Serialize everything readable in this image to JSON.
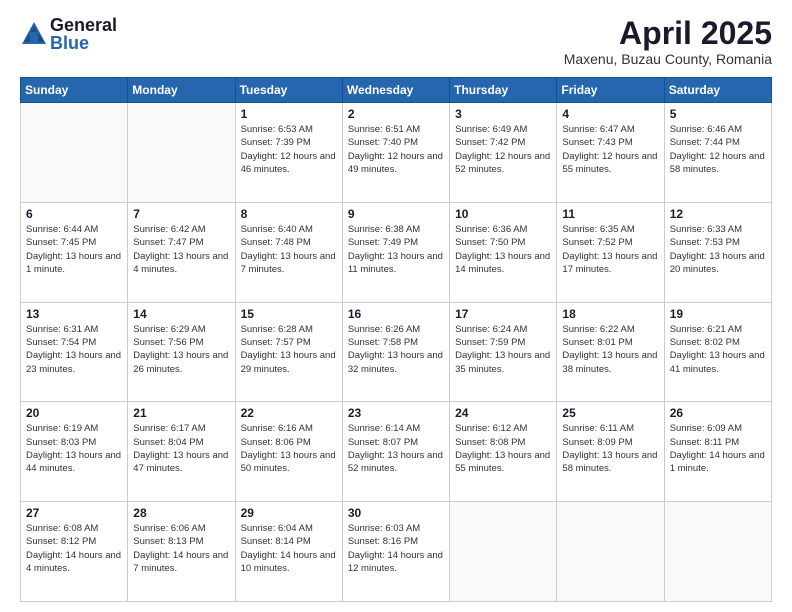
{
  "logo": {
    "general": "General",
    "blue": "Blue"
  },
  "title": {
    "month": "April 2025",
    "location": "Maxenu, Buzau County, Romania"
  },
  "days_header": [
    "Sunday",
    "Monday",
    "Tuesday",
    "Wednesday",
    "Thursday",
    "Friday",
    "Saturday"
  ],
  "weeks": [
    [
      {
        "day": "",
        "text": ""
      },
      {
        "day": "",
        "text": ""
      },
      {
        "day": "1",
        "text": "Sunrise: 6:53 AM\nSunset: 7:39 PM\nDaylight: 12 hours and 46 minutes."
      },
      {
        "day": "2",
        "text": "Sunrise: 6:51 AM\nSunset: 7:40 PM\nDaylight: 12 hours and 49 minutes."
      },
      {
        "day": "3",
        "text": "Sunrise: 6:49 AM\nSunset: 7:42 PM\nDaylight: 12 hours and 52 minutes."
      },
      {
        "day": "4",
        "text": "Sunrise: 6:47 AM\nSunset: 7:43 PM\nDaylight: 12 hours and 55 minutes."
      },
      {
        "day": "5",
        "text": "Sunrise: 6:46 AM\nSunset: 7:44 PM\nDaylight: 12 hours and 58 minutes."
      }
    ],
    [
      {
        "day": "6",
        "text": "Sunrise: 6:44 AM\nSunset: 7:45 PM\nDaylight: 13 hours and 1 minute."
      },
      {
        "day": "7",
        "text": "Sunrise: 6:42 AM\nSunset: 7:47 PM\nDaylight: 13 hours and 4 minutes."
      },
      {
        "day": "8",
        "text": "Sunrise: 6:40 AM\nSunset: 7:48 PM\nDaylight: 13 hours and 7 minutes."
      },
      {
        "day": "9",
        "text": "Sunrise: 6:38 AM\nSunset: 7:49 PM\nDaylight: 13 hours and 11 minutes."
      },
      {
        "day": "10",
        "text": "Sunrise: 6:36 AM\nSunset: 7:50 PM\nDaylight: 13 hours and 14 minutes."
      },
      {
        "day": "11",
        "text": "Sunrise: 6:35 AM\nSunset: 7:52 PM\nDaylight: 13 hours and 17 minutes."
      },
      {
        "day": "12",
        "text": "Sunrise: 6:33 AM\nSunset: 7:53 PM\nDaylight: 13 hours and 20 minutes."
      }
    ],
    [
      {
        "day": "13",
        "text": "Sunrise: 6:31 AM\nSunset: 7:54 PM\nDaylight: 13 hours and 23 minutes."
      },
      {
        "day": "14",
        "text": "Sunrise: 6:29 AM\nSunset: 7:56 PM\nDaylight: 13 hours and 26 minutes."
      },
      {
        "day": "15",
        "text": "Sunrise: 6:28 AM\nSunset: 7:57 PM\nDaylight: 13 hours and 29 minutes."
      },
      {
        "day": "16",
        "text": "Sunrise: 6:26 AM\nSunset: 7:58 PM\nDaylight: 13 hours and 32 minutes."
      },
      {
        "day": "17",
        "text": "Sunrise: 6:24 AM\nSunset: 7:59 PM\nDaylight: 13 hours and 35 minutes."
      },
      {
        "day": "18",
        "text": "Sunrise: 6:22 AM\nSunset: 8:01 PM\nDaylight: 13 hours and 38 minutes."
      },
      {
        "day": "19",
        "text": "Sunrise: 6:21 AM\nSunset: 8:02 PM\nDaylight: 13 hours and 41 minutes."
      }
    ],
    [
      {
        "day": "20",
        "text": "Sunrise: 6:19 AM\nSunset: 8:03 PM\nDaylight: 13 hours and 44 minutes."
      },
      {
        "day": "21",
        "text": "Sunrise: 6:17 AM\nSunset: 8:04 PM\nDaylight: 13 hours and 47 minutes."
      },
      {
        "day": "22",
        "text": "Sunrise: 6:16 AM\nSunset: 8:06 PM\nDaylight: 13 hours and 50 minutes."
      },
      {
        "day": "23",
        "text": "Sunrise: 6:14 AM\nSunset: 8:07 PM\nDaylight: 13 hours and 52 minutes."
      },
      {
        "day": "24",
        "text": "Sunrise: 6:12 AM\nSunset: 8:08 PM\nDaylight: 13 hours and 55 minutes."
      },
      {
        "day": "25",
        "text": "Sunrise: 6:11 AM\nSunset: 8:09 PM\nDaylight: 13 hours and 58 minutes."
      },
      {
        "day": "26",
        "text": "Sunrise: 6:09 AM\nSunset: 8:11 PM\nDaylight: 14 hours and 1 minute."
      }
    ],
    [
      {
        "day": "27",
        "text": "Sunrise: 6:08 AM\nSunset: 8:12 PM\nDaylight: 14 hours and 4 minutes."
      },
      {
        "day": "28",
        "text": "Sunrise: 6:06 AM\nSunset: 8:13 PM\nDaylight: 14 hours and 7 minutes."
      },
      {
        "day": "29",
        "text": "Sunrise: 6:04 AM\nSunset: 8:14 PM\nDaylight: 14 hours and 10 minutes."
      },
      {
        "day": "30",
        "text": "Sunrise: 6:03 AM\nSunset: 8:16 PM\nDaylight: 14 hours and 12 minutes."
      },
      {
        "day": "",
        "text": ""
      },
      {
        "day": "",
        "text": ""
      },
      {
        "day": "",
        "text": ""
      }
    ]
  ]
}
